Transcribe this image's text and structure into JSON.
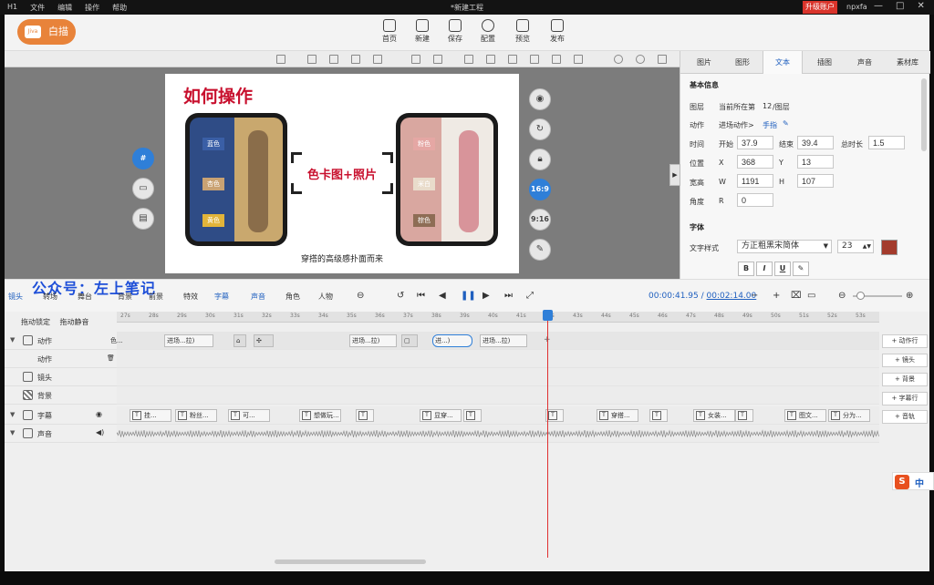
{
  "titlebar": {
    "app_icon": "H1",
    "menu": [
      "文件",
      "编辑",
      "操作",
      "帮助"
    ],
    "title": "*新建工程",
    "upgrade": "升级账户",
    "user": "npxfa",
    "win": [
      "—",
      "□",
      "✕"
    ]
  },
  "toolbar": {
    "logo": "白描",
    "logo_cam": "Jiva",
    "items": [
      "首页",
      "新建",
      "保存",
      "配置",
      "预览",
      "发布"
    ]
  },
  "preview": {
    "title": "如何操作",
    "left_chips": [
      "蓝色",
      "杏色",
      "黄色"
    ],
    "right_chips": [
      "粉色",
      "米白",
      "棕色"
    ],
    "middle_text": "色卡图+照片",
    "caption": "穿搭的高级感扑面而来"
  },
  "canvas_side": {
    "left_buttons": [
      "grid-icon",
      "layout-icon",
      "template-icon"
    ],
    "right_buttons": [
      "camera-icon",
      "rotate-icon",
      "lock-icon",
      "16:9",
      "9:16",
      "edit-icon"
    ]
  },
  "rpanel": {
    "tabs": [
      "图片",
      "图形",
      "文本",
      "插图",
      "声音",
      "素材库"
    ],
    "active_tab": "文本",
    "basic_info": "基本信息",
    "layer_label": "图层",
    "layer_value": "当前所在第",
    "layer_num": "12",
    "layer_suffix": "/图层",
    "action_label": "动作",
    "action_value": "进场动作>",
    "action_link": "手指",
    "time_label": "时间",
    "start_label": "开始",
    "start": "37.9",
    "end_label": "结束",
    "end": "39.4",
    "duration_label": "总时长",
    "duration": "1.5",
    "pos_label": "位置",
    "x_label": "X",
    "x": "368",
    "y_label": "Y",
    "y": "13",
    "size_label": "宽高",
    "w_label": "W",
    "w": "1191",
    "h_label": "H",
    "h": "107",
    "angle_label": "角度",
    "r_label": "R",
    "r": "0",
    "font_section": "字体",
    "font_style_label": "文字样式",
    "font_name": "方正粗黑宋简体",
    "font_size": "23",
    "color_swatch": "#a33b2c",
    "format_buttons": [
      "B",
      "I",
      "U",
      "✎"
    ]
  },
  "playbar": {
    "watermark": "公众号：左上笔记",
    "left_tools": [
      "镜头",
      "转场",
      "舞台",
      "背景",
      "前景",
      "特效",
      "字幕",
      "声音",
      "角色",
      "人物"
    ],
    "time_current": "00:00:41.95",
    "time_sep": " / ",
    "time_total": "00:02:14.00"
  },
  "timeline": {
    "lock_text": "拖动锁定",
    "mute_text": "拖动静音",
    "ruler": [
      "27s",
      "28s",
      "29s",
      "30s",
      "31s",
      "32s",
      "33s",
      "34s",
      "35s",
      "36s",
      "37s",
      "38s",
      "39s",
      "40s",
      "41s",
      "42s",
      "43s",
      "44s",
      "45s",
      "46s",
      "47s",
      "48s",
      "49s",
      "50s",
      "51s",
      "52s",
      "53s"
    ],
    "tracks": [
      "动作",
      "动作",
      "镜头",
      "背景",
      "字幕",
      "声音"
    ],
    "action_clips": [
      "色...",
      "进场...拉)",
      "进场...拉)",
      "进...)",
      "进场...拉)"
    ],
    "subtitle_clips": [
      "挂...",
      "粉丝...",
      "可...",
      "想做玩...",
      "显穿...",
      "穿搭...",
      "女装...",
      "图文...",
      "分为..."
    ],
    "add_buttons": [
      "+ 动作行",
      "+ 镜头",
      "+ 背景",
      "+ 字幕行",
      "+ 音轨"
    ]
  },
  "ime": {
    "logo": "S",
    "mode": "中"
  }
}
